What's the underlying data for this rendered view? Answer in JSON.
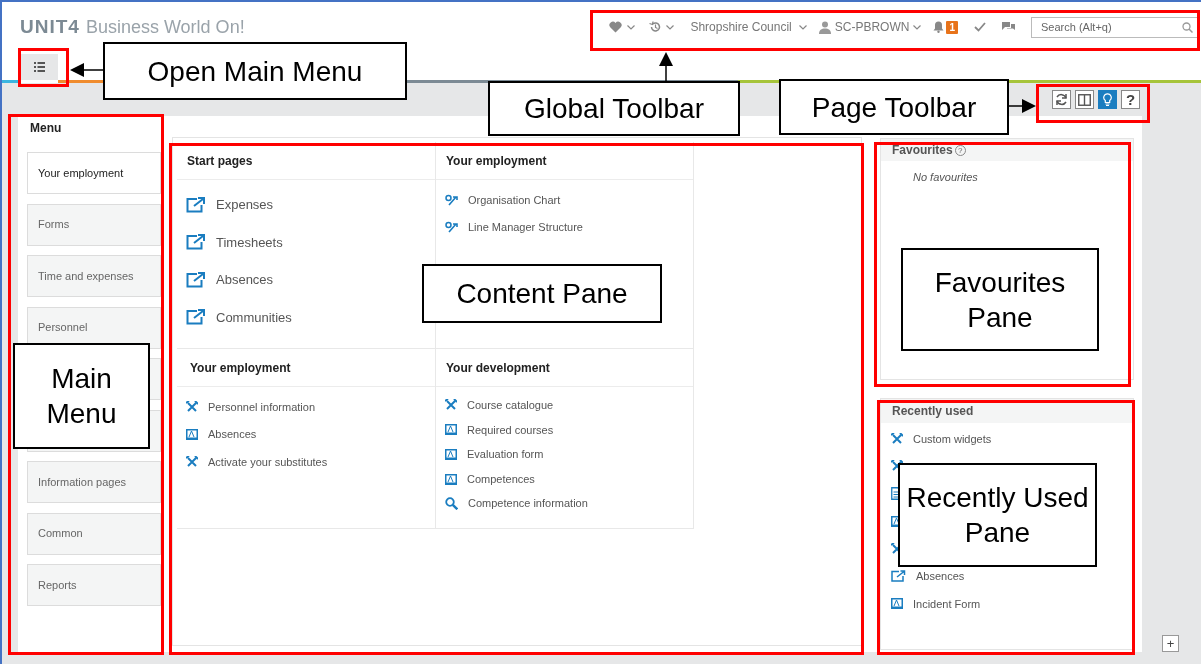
{
  "header": {
    "logo": "UNIT4",
    "app_title": "Business World On!"
  },
  "global_toolbar": {
    "company": "Shropshire Council",
    "user": "SC-PBROWN",
    "notification_count": "1",
    "search": {
      "placeholder": "Search (Alt+q)"
    }
  },
  "page_toolbar": {
    "buttons": [
      {
        "kind": "refresh",
        "on": false
      },
      {
        "kind": "split",
        "on": false
      },
      {
        "kind": "tips",
        "on": true
      },
      {
        "kind": "help",
        "label": "?",
        "on": false
      }
    ]
  },
  "menu": {
    "title": "Menu",
    "items": [
      {
        "label": "Your employment",
        "selected": true
      },
      {
        "label": "Forms",
        "selected": false
      },
      {
        "label": "Time and expenses",
        "selected": false
      },
      {
        "label": "Personnel",
        "selected": false
      },
      {
        "kind": "covered"
      },
      {
        "kind": "covered"
      },
      {
        "label": "Information pages",
        "selected": false
      },
      {
        "label": "Common",
        "selected": false
      },
      {
        "label": "Reports",
        "selected": false
      }
    ]
  },
  "content": {
    "sections": [
      {
        "title": "Start pages",
        "items": [
          {
            "kind": "external",
            "label": "Expenses"
          },
          {
            "kind": "external",
            "label": "Timesheets"
          },
          {
            "kind": "external",
            "label": "Absences"
          },
          {
            "kind": "external",
            "label": "Communities"
          }
        ]
      },
      {
        "title": "Your employment",
        "items": [
          {
            "kind": "orgchart",
            "label": "Organisation Chart"
          },
          {
            "kind": "orgchart",
            "label": "Line Manager Structure"
          }
        ]
      },
      {
        "title": "Your employment",
        "items": [
          {
            "kind": "tools",
            "label": "Personnel information"
          },
          {
            "kind": "form",
            "label": "Absences"
          },
          {
            "kind": "tools",
            "label": "Activate your substitutes"
          }
        ]
      },
      {
        "title": "Your development",
        "items": [
          {
            "kind": "tools",
            "label": "Course catalogue"
          },
          {
            "kind": "form",
            "label": "Required courses"
          },
          {
            "kind": "form",
            "label": "Evaluation form"
          },
          {
            "kind": "form",
            "label": "Competences"
          },
          {
            "kind": "search",
            "label": "Competence information"
          }
        ]
      }
    ]
  },
  "favourites": {
    "title": "Favourites",
    "help_mark": "?",
    "empty_text": "No favourites"
  },
  "recently_used": {
    "title": "Recently used",
    "items": [
      {
        "kind": "tools",
        "label": "Custom widgets"
      },
      {
        "kind": "tools"
      },
      {
        "kind": "document"
      },
      {
        "kind": "form"
      },
      {
        "kind": "tools"
      },
      {
        "kind": "external",
        "label": "Absences"
      },
      {
        "kind": "form",
        "label": "Incident Form"
      }
    ]
  },
  "add_button": {
    "label": "+"
  },
  "annotations": [
    {
      "text": "Open Main Menu"
    },
    {
      "text": "Global Toolbar"
    },
    {
      "text": "Page Toolbar"
    },
    {
      "text": "Content Pane"
    },
    {
      "text": "Main Menu"
    },
    {
      "text": "Favourites Pane"
    },
    {
      "text": "Recently Used Pane"
    }
  ]
}
